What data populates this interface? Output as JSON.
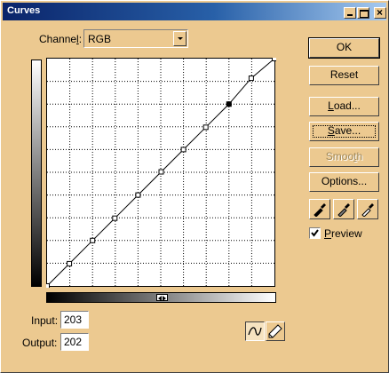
{
  "window": {
    "title": "Curves"
  },
  "titlebar_buttons": {
    "minimize_icon": "minimize-icon",
    "maximize_icon": "maximize-icon",
    "close_glyph": "×"
  },
  "channel": {
    "label_prefix": "Channe",
    "label_accel": "l",
    "label_suffix": ":",
    "value": "RGB"
  },
  "curve": {
    "points": [
      [
        0,
        0
      ],
      [
        25,
        25
      ],
      [
        51,
        51
      ],
      [
        76,
        76
      ],
      [
        102,
        102
      ],
      [
        128,
        128
      ],
      [
        153,
        153
      ],
      [
        178,
        178
      ],
      [
        204,
        204
      ],
      [
        229,
        233
      ],
      [
        255,
        255
      ]
    ],
    "range": [
      0,
      255
    ],
    "grid_divisions": 10
  },
  "input": {
    "label": "Input:",
    "value": "203"
  },
  "output": {
    "label": "Output:",
    "value": "202"
  },
  "buttons": {
    "ok": "OK",
    "reset": "Reset",
    "load": {
      "accel": "L",
      "rest": "oad..."
    },
    "save": {
      "accel": "S",
      "rest": "ave..."
    },
    "smooth": {
      "pre": "Smoo",
      "accel": "t",
      "rest": "h"
    },
    "options": "Options..."
  },
  "eyedroppers": [
    "black-eyedropper-icon",
    "gray-eyedropper-icon",
    "white-eyedropper-icon"
  ],
  "preview": {
    "accel": "P",
    "rest": "review",
    "checked": true
  },
  "tools": {
    "curve": "curve-tool-icon",
    "pencil": "pencil-tool-icon"
  },
  "colors": {
    "dialog_bg": "#ecc990",
    "title_start": "#0a246a",
    "title_end": "#a6caf0"
  }
}
